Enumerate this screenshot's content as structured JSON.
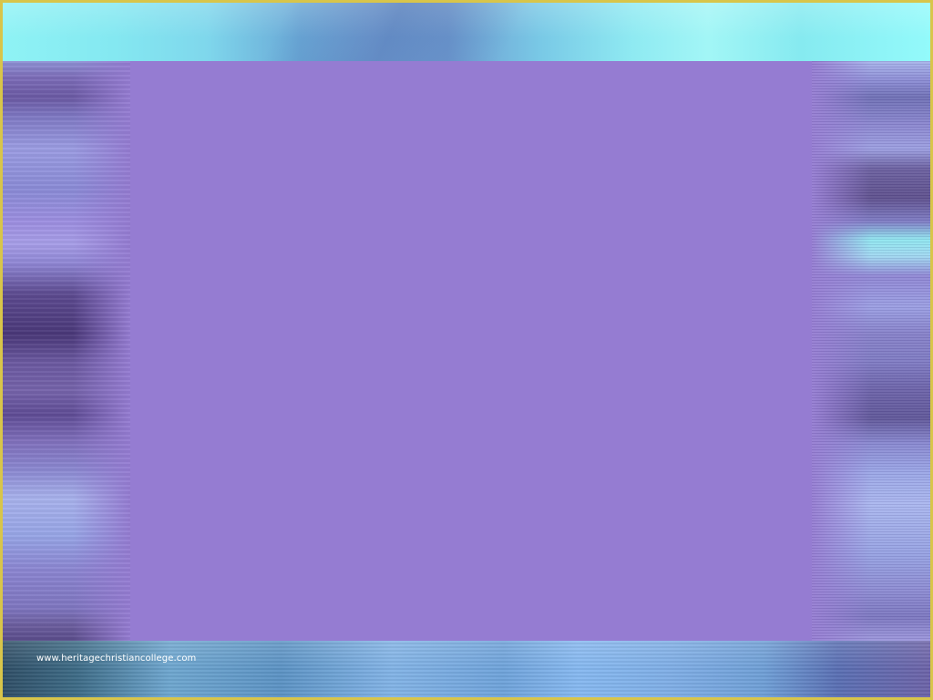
{
  "slide": {
    "footer_url": "www.heritagechristiancollege.com"
  },
  "colors": {
    "frame": "#d8c54a",
    "panel": "#957cd2",
    "top_band": "#8ff3f5",
    "bottom_band": "#6ea6cf"
  }
}
